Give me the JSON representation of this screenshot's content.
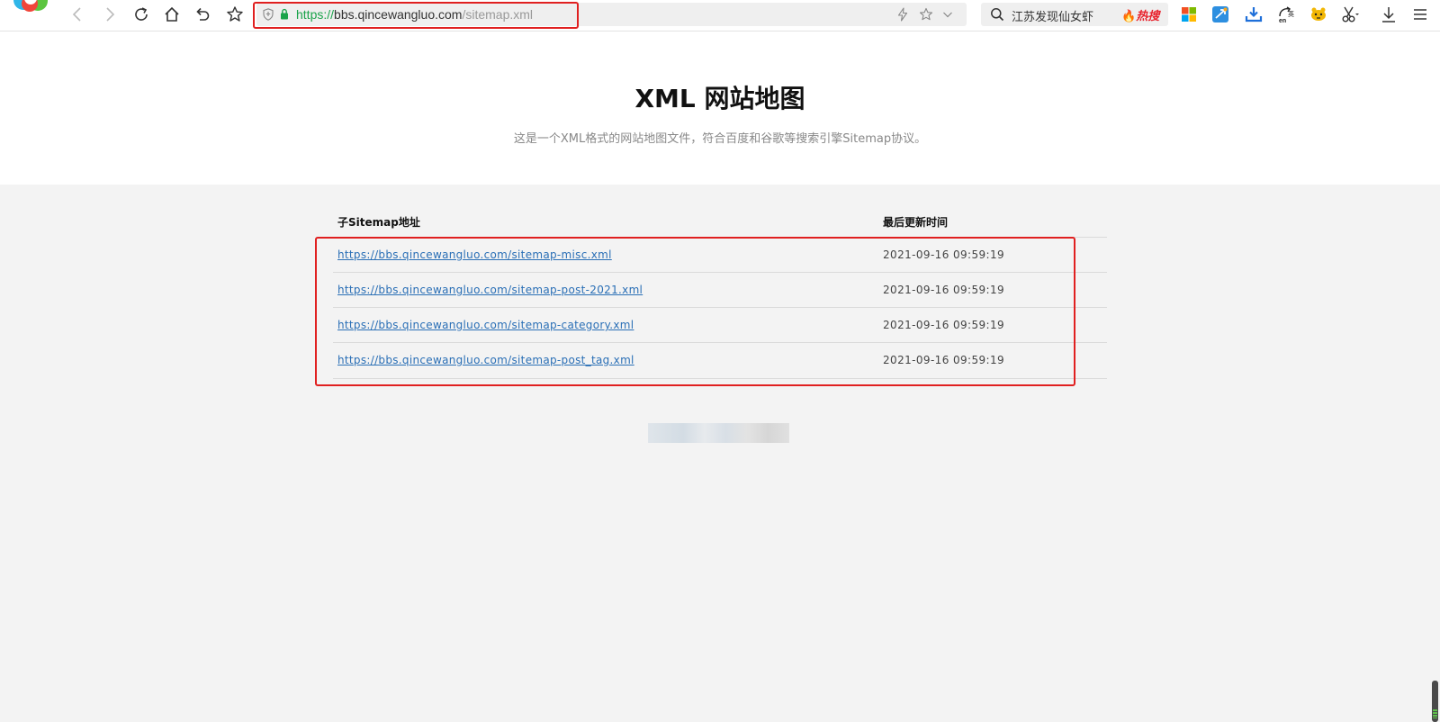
{
  "browser": {
    "url_scheme": "https://",
    "url_host": "bbs.qincewangluo.com",
    "url_path": "/sitemap.xml",
    "search_text": "江苏发现仙女虾",
    "hot_label": "热搜"
  },
  "page": {
    "title": "XML 网站地图",
    "description": "这是一个XML格式的网站地图文件，符合百度和谷歌等搜索引擎Sitemap协议。"
  },
  "table": {
    "col_url": "子Sitemap地址",
    "col_time": "最后更新时间",
    "rows": [
      {
        "url": "https://bbs.qincewangluo.com/sitemap-misc.xml",
        "time": "2021-09-16 09:59:19"
      },
      {
        "url": "https://bbs.qincewangluo.com/sitemap-post-2021.xml",
        "time": "2021-09-16 09:59:19"
      },
      {
        "url": "https://bbs.qincewangluo.com/sitemap-category.xml",
        "time": "2021-09-16 09:59:19"
      },
      {
        "url": "https://bbs.qincewangluo.com/sitemap-post_tag.xml",
        "time": "2021-09-16 09:59:19"
      }
    ]
  },
  "colors": {
    "link": "#2a6fb6",
    "highlight": "#e02020",
    "https_green": "#1aa34a"
  },
  "icons": [
    "browser-logo-icon",
    "back-icon",
    "forward-icon",
    "refresh-icon",
    "home-icon",
    "undo-icon",
    "bookmark-star-icon",
    "shield-icon",
    "lock-icon",
    "lightning-icon",
    "star-icon",
    "chevron-down-icon",
    "search-icon",
    "apps-grid-icon",
    "send-icon",
    "download-box-icon",
    "translate-icon",
    "tiger-icon",
    "scissors-icon",
    "download-icon",
    "menu-icon"
  ]
}
